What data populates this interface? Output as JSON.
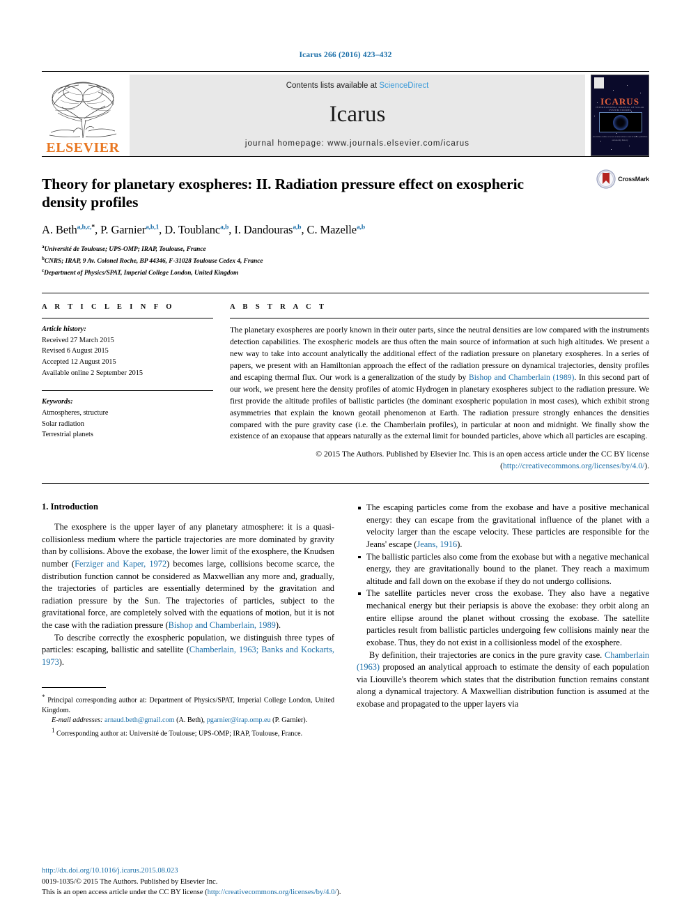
{
  "running_head": "Icarus 266 (2016) 423–432",
  "masthead": {
    "publisher_name": "ELSEVIER",
    "contents_prefix": "Contents lists available at ",
    "contents_link": "ScienceDirect",
    "journal_title": "Icarus",
    "homepage_label": "journal homepage: www.journals.elsevier.com/icarus",
    "cover": {
      "title": "ICARUS",
      "subtitle": "INTERNATIONAL JOURNAL OF SOLAR SYSTEM STUDIES",
      "caption": "Available online at www.sciencedirect.com\nScience publishes astronomy history"
    }
  },
  "article": {
    "title": "Theory for planetary exospheres: II. Radiation pressure effect on exospheric density profiles",
    "authors": [
      {
        "name": "A. Beth",
        "sup": "a,b,c,",
        "star": "*"
      },
      {
        "name": "P. Garnier",
        "sup": "a,b,1"
      },
      {
        "name": "D. Toublanc",
        "sup": "a,b"
      },
      {
        "name": "I. Dandouras",
        "sup": "a,b"
      },
      {
        "name": "C. Mazelle",
        "sup": "a,b"
      }
    ],
    "affiliations": [
      {
        "mark": "a",
        "text": "Université de Toulouse; UPS-OMP; IRAP, Toulouse, France"
      },
      {
        "mark": "b",
        "text": "CNRS; IRAP, 9 Av. Colonel Roche, BP 44346, F-31028 Toulouse Cedex 4, France"
      },
      {
        "mark": "c",
        "text": "Department of Physics/SPAT, Imperial College London, United Kingdom"
      }
    ],
    "crossmark_label": "CrossMark"
  },
  "article_info": {
    "heading": "A R T I C L E   I N F O",
    "history_label": "Article history:",
    "history": [
      "Received 27 March 2015",
      "Revised 6 August 2015",
      "Accepted 12 August 2015",
      "Available online 2 September 2015"
    ],
    "keywords_label": "Keywords:",
    "keywords": [
      "Atmospheres, structure",
      "Solar radiation",
      "Terrestrial planets"
    ]
  },
  "abstract": {
    "heading": "A B S T R A C T",
    "part1": "The planetary exospheres are poorly known in their outer parts, since the neutral densities are low compared with the instruments detection capabilities. The exospheric models are thus often the main source of information at such high altitudes. We present a new way to take into account analytically the additional effect of the radiation pressure on planetary exospheres. In a series of papers, we present with an Hamiltonian approach the effect of the radiation pressure on dynamical trajectories, density profiles and escaping thermal flux. Our work is a generalization of the study by ",
    "ref1": "Bishop and Chamberlain (1989)",
    "part2": ". In this second part of our work, we present here the density profiles of atomic Hydrogen in planetary exospheres subject to the radiation pressure. We first provide the altitude profiles of ballistic particles (the dominant exospheric population in most cases), which exhibit strong asymmetries that explain the known geotail phenomenon at Earth. The radiation pressure strongly enhances the densities compared with the pure gravity case (i.e. the Chamberlain profiles), in particular at noon and midnight. We finally show the existence of an exopause that appears naturally as the external limit for bounded particles, above which all particles are escaping.",
    "copyright": "© 2015 The Authors. Published by Elsevier Inc. This is an open access article under the CC BY license",
    "license_open": "(",
    "license_link": "http://creativecommons.org/licenses/by/4.0/",
    "license_close": ")."
  },
  "introduction": {
    "heading": "1. Introduction",
    "para1_a": "The exosphere is the upper layer of any planetary atmosphere: it is a quasi-collisionless medium where the particle trajectories are more dominated by gravity than by collisions. Above the exobase, the lower limit of the exosphere, the Knudsen number (",
    "para1_ref": "Ferziger and Kaper, 1972",
    "para1_b": ") becomes large, collisions become scarce, the distribution function cannot be considered as Maxwellian any more and, gradually, the trajectories of particles are essentially determined by the gravitation and radiation pressure by the Sun. The trajectories of particles, subject to the gravitational force, are completely solved with the equations of motion, but it is not the case with the radiation pressure (",
    "para1_ref2": "Bishop and Chamberlain, 1989",
    "para1_c": ").",
    "para2_a": "To describe correctly the exospheric population, we distinguish three types of particles: escaping, ballistic and satellite (",
    "para2_ref": "Chamberlain, 1963; Banks and Kockarts, 1973",
    "para2_b": ")."
  },
  "bullets": [
    {
      "a": "The escaping particles come from the exobase and have a positive mechanical energy: they can escape from the gravitational influence of the planet with a velocity larger than the escape velocity. These particles are responsible for the Jeans' escape (",
      "ref": "Jeans, 1916",
      "b": ")."
    },
    {
      "a": "The ballistic particles also come from the exobase but with a negative mechanical energy, they are gravitationally bound to the planet. They reach a maximum altitude and fall down on the exobase if they do not undergo collisions.",
      "ref": "",
      "b": ""
    },
    {
      "a": "The satellite particles never cross the exobase. They also have a negative mechanical energy but their periapsis is above the exobase: they orbit along an entire ellipse around the planet without crossing the exobase. The satellite particles result from ballistic particles undergoing few collisions mainly near the exobase. Thus, they do not exist in a collisionless model of the exosphere.",
      "ref": "",
      "b": ""
    }
  ],
  "closing_para": {
    "a": "By definition, their trajectories are conics in the pure gravity case. ",
    "ref": "Chamberlain (1963)",
    "b": " proposed an analytical approach to estimate the density of each population via Liouville's theorem which states that the distribution function remains constant along a dynamical trajectory. A Maxwellian distribution function is assumed at the exobase and propagated to the upper layers via"
  },
  "footnotes": {
    "star_mark": "*",
    "star_text": " Principal corresponding author at: Department of Physics/SPAT, Imperial College London, United Kingdom.",
    "email_label": "E-mail addresses:",
    "email1": "arnaud.beth@gmail.com",
    "email1_who": " (A. Beth), ",
    "email2": "pgarnier@irap.omp.eu",
    "email2_who": " (P. Garnier).",
    "one_mark": "1",
    "one_text": " Corresponding author at: Université de Toulouse; UPS-OMP; IRAP, Toulouse, France."
  },
  "bottom": {
    "doi": "http://dx.doi.org/10.1016/j.icarus.2015.08.023",
    "issn_line": "0019-1035/© 2015 The Authors. Published by Elsevier Inc.",
    "license_pre": "This is an open access article under the CC BY license (",
    "license_link": "http://creativecommons.org/licenses/by/4.0/",
    "license_post": ")."
  },
  "colors": {
    "link_blue": "#1a6ea8",
    "sciencedirect_blue": "#3a9ad9",
    "elsevier_orange": "#E87722",
    "crossmark_red": "#b4231f"
  }
}
